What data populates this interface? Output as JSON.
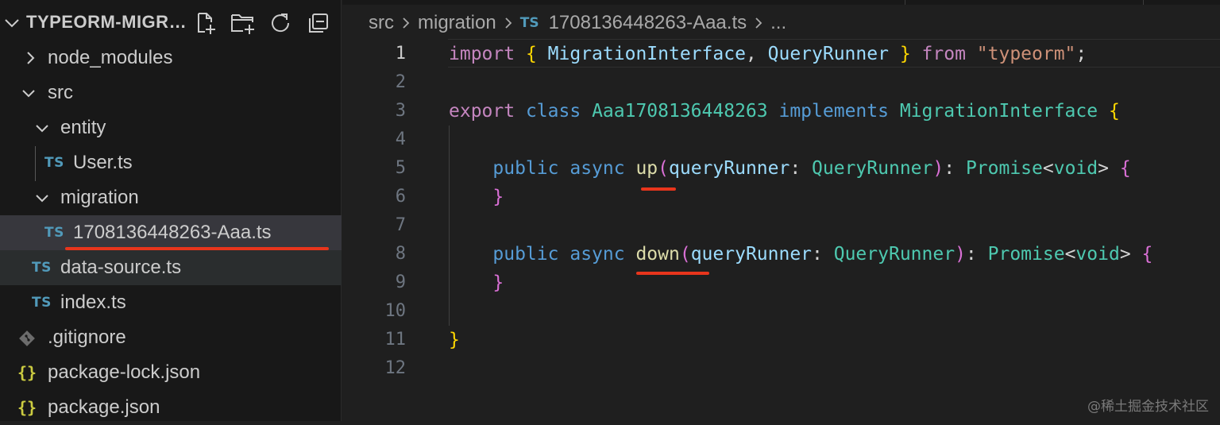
{
  "explorer": {
    "title": "TYPEORM-MIGRATION",
    "actions": [
      "new-file-icon",
      "new-folder-icon",
      "refresh-icon",
      "collapse-all-icon"
    ],
    "tree": [
      {
        "label": "node_modules",
        "kind": "folder",
        "state": "collapsed",
        "depth": 0
      },
      {
        "label": "src",
        "kind": "folder",
        "state": "expanded",
        "depth": 0
      },
      {
        "label": "entity",
        "kind": "folder",
        "state": "expanded",
        "depth": 1
      },
      {
        "label": "User.ts",
        "kind": "ts",
        "depth": 2
      },
      {
        "label": "migration",
        "kind": "folder",
        "state": "expanded",
        "depth": 1
      },
      {
        "label": "1708136448263-Aaa.ts",
        "kind": "ts",
        "depth": 2,
        "selected": true
      },
      {
        "label": "data-source.ts",
        "kind": "ts",
        "depth": 1
      },
      {
        "label": "index.ts",
        "kind": "ts",
        "depth": 1
      },
      {
        "label": ".gitignore",
        "kind": "git",
        "depth": 0
      },
      {
        "label": "package-lock.json",
        "kind": "json",
        "depth": 0
      },
      {
        "label": "package.json",
        "kind": "json",
        "depth": 0
      }
    ],
    "ts_badge": "TS",
    "json_badge": "{}"
  },
  "breadcrumb": {
    "items": [
      "src",
      "migration",
      "1708136448263-Aaa.ts",
      "..."
    ],
    "ts_badge": "TS"
  },
  "editor": {
    "active_line": 1,
    "lines": [
      {
        "n": "1",
        "tokens": [
          [
            "import",
            "kw"
          ],
          [
            " ",
            "pl"
          ],
          [
            "{",
            "br1"
          ],
          [
            " ",
            "pl"
          ],
          [
            "MigrationInterface",
            "id"
          ],
          [
            ", ",
            "pl"
          ],
          [
            "QueryRunner",
            "id"
          ],
          [
            " ",
            "pl"
          ],
          [
            "}",
            "br1"
          ],
          [
            " ",
            "pl"
          ],
          [
            "from",
            "kw"
          ],
          [
            " ",
            "pl"
          ],
          [
            "\"typeorm\"",
            "str"
          ],
          [
            ";",
            "pl"
          ]
        ]
      },
      {
        "n": "2",
        "tokens": []
      },
      {
        "n": "3",
        "tokens": [
          [
            "export",
            "kw"
          ],
          [
            " ",
            "pl"
          ],
          [
            "class",
            "kb"
          ],
          [
            " ",
            "pl"
          ],
          [
            "Aaa1708136448263",
            "ty"
          ],
          [
            " ",
            "pl"
          ],
          [
            "implements",
            "kb"
          ],
          [
            " ",
            "pl"
          ],
          [
            "MigrationInterface",
            "ty"
          ],
          [
            " ",
            "pl"
          ],
          [
            "{",
            "br1"
          ]
        ]
      },
      {
        "n": "4",
        "tokens": []
      },
      {
        "n": "5",
        "tokens": [
          [
            "    ",
            "pl"
          ],
          [
            "public",
            "kb"
          ],
          [
            " ",
            "pl"
          ],
          [
            "async",
            "kb"
          ],
          [
            " ",
            "pl"
          ],
          [
            "up",
            "fn"
          ],
          [
            "(",
            "br2"
          ],
          [
            "queryRunner",
            "id"
          ],
          [
            ": ",
            "pl"
          ],
          [
            "QueryRunner",
            "ty"
          ],
          [
            ")",
            "br2"
          ],
          [
            ": ",
            "pl"
          ],
          [
            "Promise",
            "ty"
          ],
          [
            "<",
            "pl"
          ],
          [
            "void",
            "ty"
          ],
          [
            "> ",
            "pl"
          ],
          [
            "{",
            "br2"
          ]
        ]
      },
      {
        "n": "6",
        "tokens": [
          [
            "    ",
            "pl"
          ],
          [
            "}",
            "br2"
          ]
        ]
      },
      {
        "n": "7",
        "tokens": []
      },
      {
        "n": "8",
        "tokens": [
          [
            "    ",
            "pl"
          ],
          [
            "public",
            "kb"
          ],
          [
            " ",
            "pl"
          ],
          [
            "async",
            "kb"
          ],
          [
            " ",
            "pl"
          ],
          [
            "down",
            "fn"
          ],
          [
            "(",
            "br2"
          ],
          [
            "queryRunner",
            "id"
          ],
          [
            ": ",
            "pl"
          ],
          [
            "QueryRunner",
            "ty"
          ],
          [
            ")",
            "br2"
          ],
          [
            ": ",
            "pl"
          ],
          [
            "Promise",
            "ty"
          ],
          [
            "<",
            "pl"
          ],
          [
            "void",
            "ty"
          ],
          [
            "> ",
            "pl"
          ],
          [
            "{",
            "br2"
          ]
        ]
      },
      {
        "n": "9",
        "tokens": [
          [
            "    ",
            "pl"
          ],
          [
            "}",
            "br2"
          ]
        ]
      },
      {
        "n": "10",
        "tokens": []
      },
      {
        "n": "11",
        "tokens": [
          [
            "}",
            "br1"
          ]
        ]
      },
      {
        "n": "12",
        "tokens": []
      }
    ]
  },
  "colors": {
    "annotation_red": "#e8351c",
    "ts_icon": "#519aba",
    "json_icon": "#cbcb41"
  },
  "watermark": "@稀土掘金技术社区"
}
